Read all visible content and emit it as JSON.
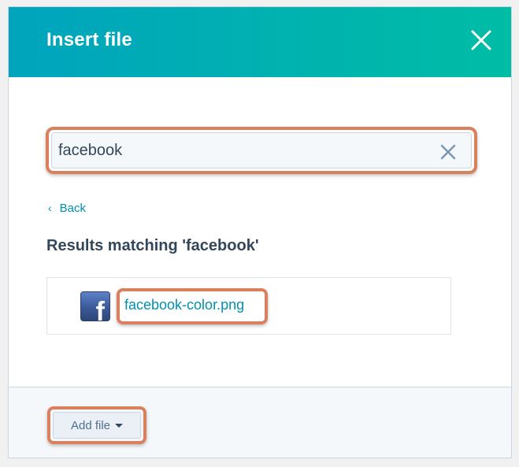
{
  "modal": {
    "title": "Insert file",
    "close_icon": "close-icon"
  },
  "search": {
    "value": "facebook",
    "clear_icon": "clear-icon"
  },
  "navigation": {
    "back_chevron": "‹",
    "back_label": "Back"
  },
  "results": {
    "heading": "Results matching 'facebook'",
    "items": [
      {
        "filename": "facebook-color.png",
        "thumbnail_letter": "f",
        "thumbnail_icon": "facebook-logo-icon"
      }
    ]
  },
  "footer": {
    "add_file_label": "Add file",
    "caret_icon": "caret-down-icon"
  },
  "colors": {
    "header_gradient_start": "#00a4bd",
    "header_gradient_end": "#00bda5",
    "link": "#0091ae",
    "text": "#33475b",
    "highlight": "#d9805f"
  }
}
